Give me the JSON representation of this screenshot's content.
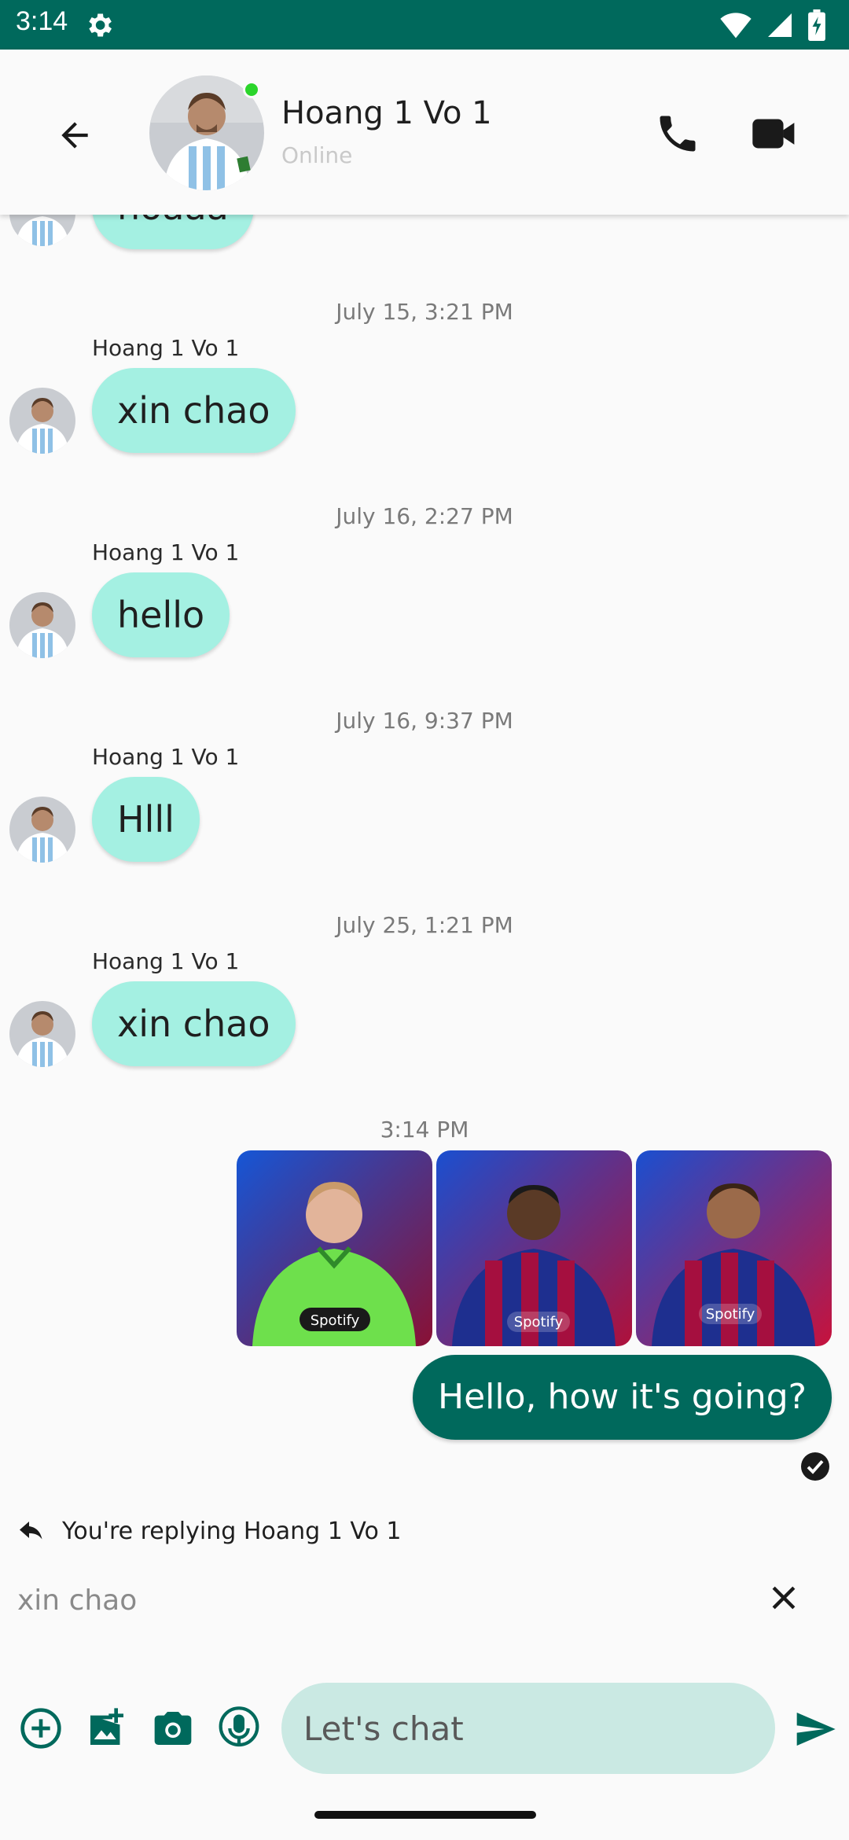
{
  "status_bar": {
    "time": "3:14"
  },
  "header": {
    "contact_name": "Hoang 1 Vo 1",
    "presence": "Online"
  },
  "messages": {
    "partial_text": "hoaaa",
    "groups": [
      {
        "date": "July 15, 3:21 PM",
        "sender": "Hoang 1 Vo 1",
        "text": "xin chao"
      },
      {
        "date": "July 16, 2:27 PM",
        "sender": "Hoang 1 Vo 1",
        "text": "hello"
      },
      {
        "date": "July 16, 9:37 PM",
        "sender": "Hoang 1 Vo 1",
        "text": "Hlll"
      },
      {
        "date": "July 25, 1:21 PM",
        "sender": "Hoang 1 Vo 1",
        "text": "xin chao"
      }
    ],
    "outgoing": {
      "date": "3:14 PM",
      "text": "Hello, how it's going?"
    },
    "photo_sponsor": "Spotify"
  },
  "reply": {
    "label": "You're replying Hoang 1 Vo 1",
    "quoted_text": "xin chao"
  },
  "composer": {
    "placeholder": "Let's chat"
  },
  "colors": {
    "primary": "#00695c",
    "incoming_bubble": "#a4f0e2",
    "input_background": "#cae9e3",
    "online": "#2bd52b"
  }
}
